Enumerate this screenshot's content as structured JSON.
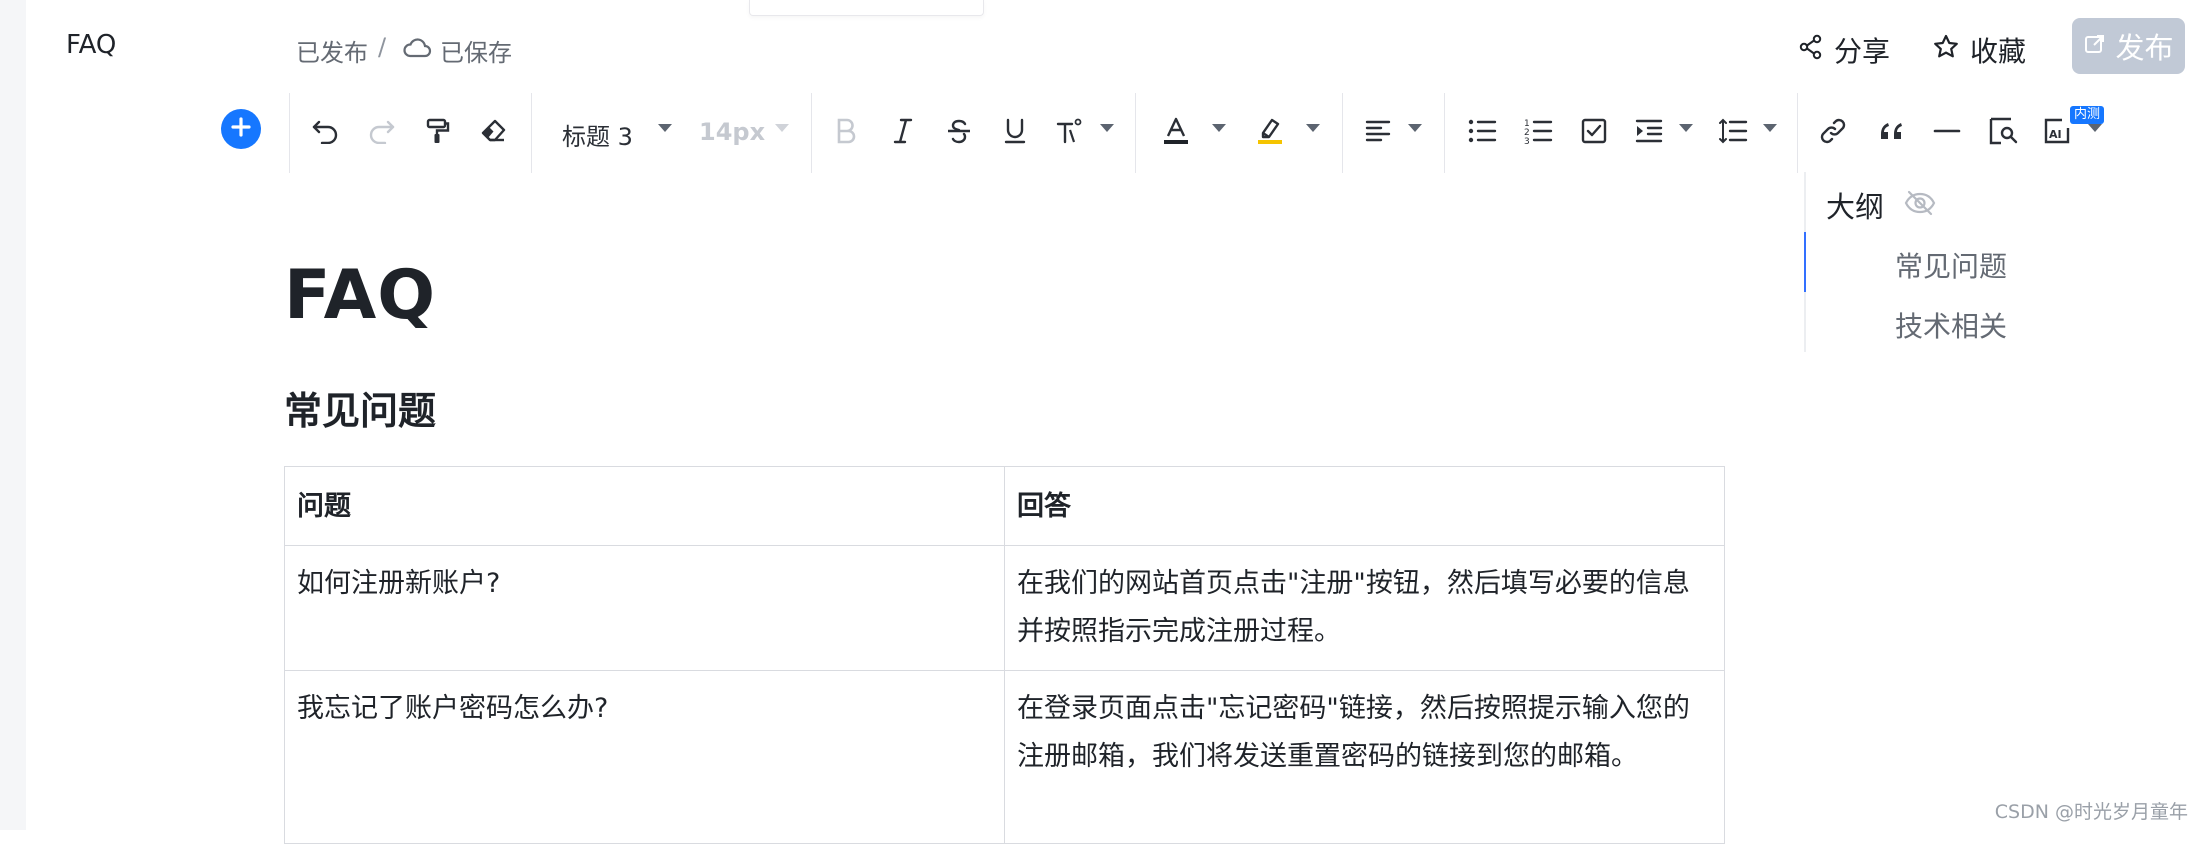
{
  "header": {
    "doc_name": "FAQ",
    "published": "已发布",
    "separator": "/",
    "saved": "已保存",
    "share": "分享",
    "favorite": "收藏",
    "publish": "发布"
  },
  "toolbar": {
    "heading_style": "标题 3",
    "font_size": "14px",
    "beta_badge": "内测"
  },
  "outline": {
    "title": "大纲",
    "items": [
      "常见问题",
      "技术相关"
    ],
    "active_index": 0
  },
  "document": {
    "title": "FAQ",
    "section_heading": "常见问题",
    "table": {
      "headers": [
        "问题",
        "回答"
      ],
      "rows": [
        [
          "如何注册新账户?",
          "在我们的网站首页点击\"注册\"按钮，然后填写必要的信息并按照指示完成注册过程。"
        ],
        [
          "我忘记了账户密码怎么办?",
          "在登录页面点击\"忘记密码\"链接，然后按照提示输入您的注册邮箱，我们将发送重置密码的链接到您的邮箱。"
        ]
      ]
    }
  },
  "watermark": "CSDN @时光岁月童年",
  "colors": {
    "accent": "#1677ff",
    "outline_active": "#3370ff",
    "highlight": "#f5c400",
    "publish_disabled": "#c1c9d6"
  }
}
